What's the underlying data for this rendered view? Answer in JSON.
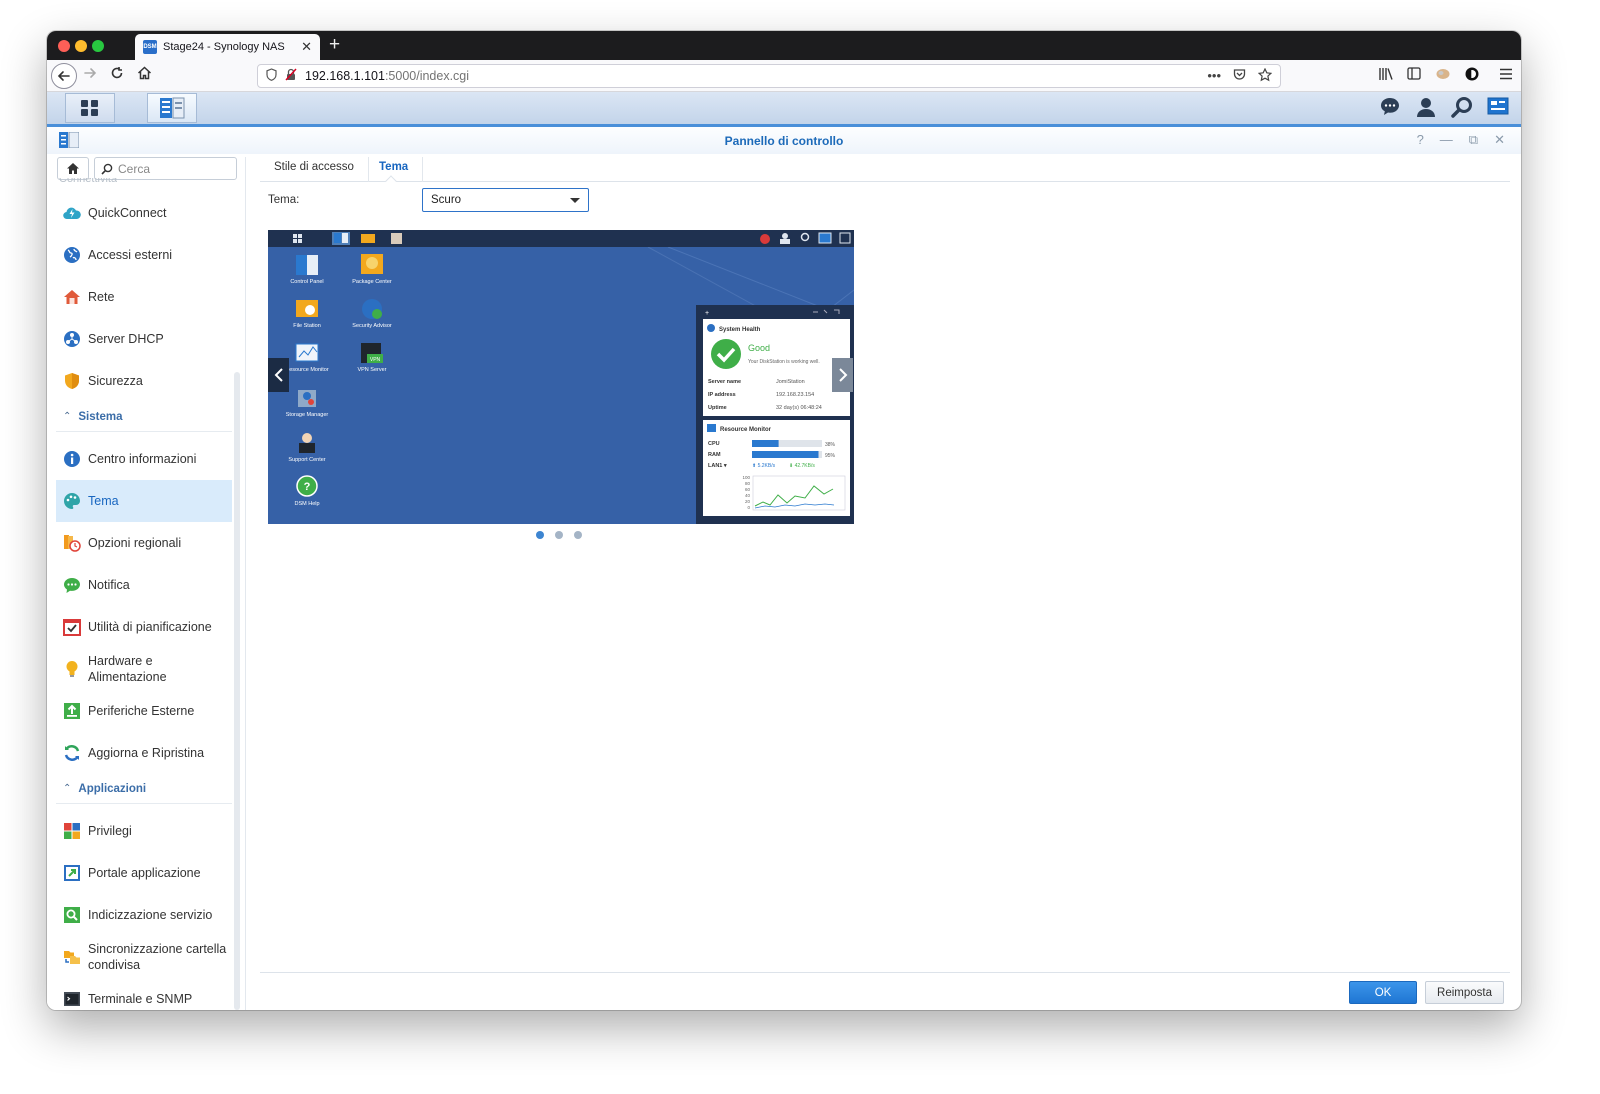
{
  "browser": {
    "tab_title": "Stage24 - Synology NAS",
    "favicon_text": "DSM",
    "new_tab_symbol": "+",
    "url_host": "192.168.1.101",
    "url_path": ":5000/index.cgi"
  },
  "dsm": {
    "window_title": "Pannello di controllo",
    "window_controls": [
      "?",
      "—",
      "⧉",
      "✕"
    ]
  },
  "sidebar": {
    "search_placeholder": "Cerca",
    "cut_item": "Connettività",
    "items": [
      {
        "label": "QuickConnect",
        "icon": "quickconnect-icon",
        "color": "#2fa4c7"
      },
      {
        "label": "Accessi esterni",
        "icon": "globe-icon",
        "color": "#2b6fc2"
      },
      {
        "label": "Rete",
        "icon": "house-icon",
        "color": "#e05a3a"
      },
      {
        "label": "Server DHCP",
        "icon": "network-icon",
        "color": "#2b6fc2"
      },
      {
        "label": "Sicurezza",
        "icon": "shield-icon",
        "color": "#f2a81e"
      }
    ],
    "section_system": "Sistema",
    "system_items": [
      {
        "label": "Centro informazioni",
        "icon": "info-icon",
        "color": "#2b6fc2"
      },
      {
        "label": "Tema",
        "icon": "palette-icon",
        "color": "#2fa4a8",
        "active": true
      },
      {
        "label": "Opzioni regionali",
        "icon": "clock-icon",
        "color": "#f29a1e"
      },
      {
        "label": "Notifica",
        "icon": "chat-icon",
        "color": "#3fae48"
      },
      {
        "label": "Utilità di pianificazione",
        "icon": "calendar-icon",
        "color": "#d93a3a"
      },
      {
        "label_line1": "Hardware e",
        "label_line2": "Alimentazione",
        "icon": "bulb-icon",
        "color": "#f2b21e"
      },
      {
        "label": "Periferiche Esterne",
        "icon": "upload-icon",
        "color": "#3fae48"
      },
      {
        "label": "Aggiorna e Ripristina",
        "icon": "refresh-icon",
        "color": "#2fa45a"
      }
    ],
    "section_apps": "Applicazioni",
    "app_items": [
      {
        "label": "Privilegi",
        "icon": "grid-icon",
        "color": "#e0443a"
      },
      {
        "label": "Portale applicazione",
        "icon": "portal-icon",
        "color": "#2b6fc2"
      },
      {
        "label": "Indicizzazione servizio",
        "icon": "search-index-icon",
        "color": "#3fae48"
      },
      {
        "label_line1": "Sincronizzazione cartella",
        "label_line2": "condivisa",
        "icon": "sync-folder-icon",
        "color": "#f2a81e"
      },
      {
        "label": "Terminale e SNMP",
        "icon": "terminal-icon",
        "color": "#444c56"
      }
    ]
  },
  "main": {
    "tabs": [
      "Stile di accesso",
      "Tema"
    ],
    "active_tab": "Tema",
    "theme_label": "Tema:",
    "theme_value": "Scuro",
    "carousel_pages": 3,
    "carousel_active": 1,
    "ok_label": "OK",
    "reset_label": "Reimposta"
  },
  "preview": {
    "desktop_icons": [
      "Control Panel",
      "Package Center",
      "File Station",
      "Security Advisor",
      "Resource Monitor",
      "VPN Server",
      "Storage Manager",
      "Support Center",
      "DSM Help"
    ],
    "vpn_badge": "VPN",
    "health_title": "System Health",
    "health_status": "Good",
    "health_desc": "Your DiskStation is working well.",
    "health_rows": [
      {
        "k": "Server name",
        "v": "JomiStation"
      },
      {
        "k": "IP address",
        "v": "192.168.23.154"
      },
      {
        "k": "Uptime",
        "v": "32 day(s) 06:48:24"
      }
    ],
    "resource_title": "Resource Monitor",
    "cpu_label": "CPU",
    "cpu_value": 38,
    "cpu_text": "38%",
    "ram_label": "RAM",
    "ram_value": 95,
    "ram_text": "95%",
    "lan_label": "LAN1 ▾",
    "lan_up": "⬆ 5.2KB/s",
    "lan_down": "⬇ 42.7KB/s",
    "chart_ticks": [
      "100",
      "80",
      "60",
      "40",
      "20",
      "0"
    ]
  }
}
